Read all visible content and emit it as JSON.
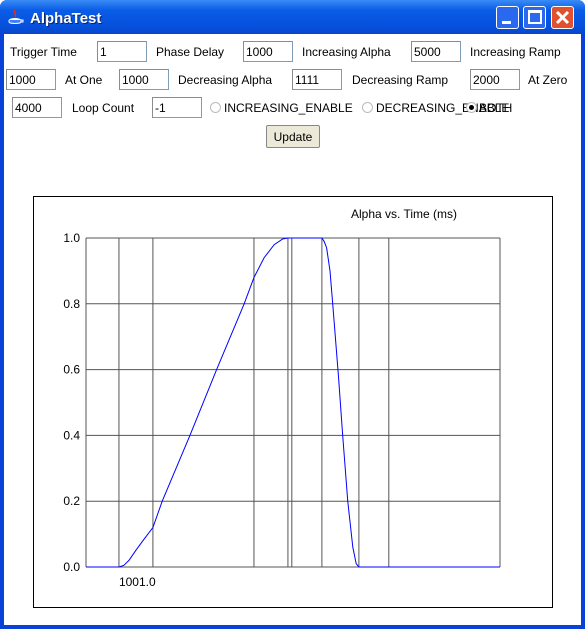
{
  "window": {
    "title": "AlphaTest",
    "colors": {
      "titlebar": "#0550dc",
      "close": "#e0522e"
    }
  },
  "form": {
    "trigger_time": {
      "label": "Trigger Time",
      "value": "1"
    },
    "phase_delay": {
      "label": "Phase Delay",
      "value": "1000"
    },
    "increasing_alpha": {
      "label": "Increasing Alpha",
      "value": "5000"
    },
    "increasing_ramp": {
      "label": "Increasing Ramp",
      "value": "1000"
    },
    "at_one": {
      "label": "At One",
      "value": "1000"
    },
    "decreasing_alpha": {
      "label": "Decreasing Alpha",
      "value": "1111"
    },
    "decreasing_ramp": {
      "label": "Decreasing Ramp",
      "value": "2000"
    },
    "at_zero": {
      "label": "At Zero",
      "value": "4000"
    },
    "loop_count": {
      "label": "Loop Count",
      "value": "-1"
    },
    "modes": [
      {
        "label": "INCREASING_ENABLE",
        "selected": false
      },
      {
        "label": "DECREASING_ENABLE",
        "selected": false
      },
      {
        "label": "BOTH",
        "selected": true
      }
    ],
    "update_label": "Update"
  },
  "chart_data": {
    "type": "line",
    "title": "Alpha vs. Time (ms)",
    "xlim": [
      806,
      3256
    ],
    "ylim": [
      0,
      1
    ],
    "yticks": [
      "0.0",
      "0.2",
      "0.4",
      "0.6",
      "0.8",
      "1.0"
    ],
    "xtick_labels": [
      {
        "x": 1001,
        "label": "1001.0"
      }
    ],
    "vertical_gridlines": [
      1001,
      1202,
      1800,
      2001,
      2024,
      2202,
      2421,
      2598
    ],
    "grid": true,
    "line_color": "#0000ff",
    "points": [
      [
        806,
        0
      ],
      [
        1001,
        0
      ],
      [
        1030,
        0.005
      ],
      [
        1060,
        0.02
      ],
      [
        1100,
        0.05
      ],
      [
        1150,
        0.085
      ],
      [
        1202,
        0.12
      ],
      [
        1257,
        0.2
      ],
      [
        1421,
        0.4
      ],
      [
        1579,
        0.6
      ],
      [
        1742,
        0.8
      ],
      [
        1800,
        0.88
      ],
      [
        1860,
        0.94
      ],
      [
        1920,
        0.98
      ],
      [
        1970,
        0.997
      ],
      [
        2001,
        1
      ],
      [
        2202,
        1
      ],
      [
        2215,
        0.99
      ],
      [
        2230,
        0.97
      ],
      [
        2250,
        0.9
      ],
      [
        2266,
        0.8
      ],
      [
        2300,
        0.58
      ],
      [
        2325,
        0.4
      ],
      [
        2355,
        0.2
      ],
      [
        2385,
        0.06
      ],
      [
        2405,
        0.01
      ],
      [
        2421,
        0
      ],
      [
        3256,
        0
      ]
    ]
  }
}
